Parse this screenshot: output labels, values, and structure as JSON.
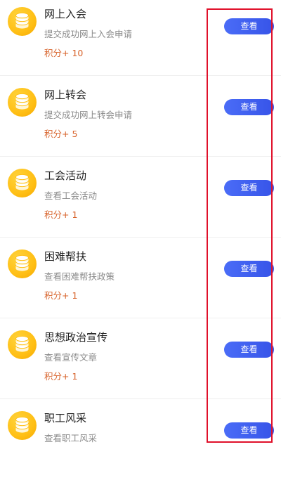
{
  "colors": {
    "button": "#3f5ff0",
    "points": "#d7622a",
    "coin": "#ffbf15",
    "highlight": "#e0102a"
  },
  "items": [
    {
      "title": "网上入会",
      "desc": "提交成功网上入会申请",
      "points": "积分+ 10",
      "button": "查看",
      "icon": "coin-stack-icon"
    },
    {
      "title": "网上转会",
      "desc": "提交成功网上转会申请",
      "points": "积分+ 5",
      "button": "查看",
      "icon": "coin-stack-icon"
    },
    {
      "title": "工会活动",
      "desc": "查看工会活动",
      "points": "积分+ 1",
      "button": "查看",
      "icon": "coin-stack-icon"
    },
    {
      "title": "困难帮扶",
      "desc": "查看困难帮扶政策",
      "points": "积分+ 1",
      "button": "查看",
      "icon": "coin-stack-icon"
    },
    {
      "title": "思想政治宣传",
      "desc": "查看宣传文章",
      "points": "积分+ 1",
      "button": "查看",
      "icon": "coin-stack-icon"
    },
    {
      "title": "职工风采",
      "desc": "查看职工风采",
      "points": "",
      "button": "查看",
      "icon": "coin-stack-icon"
    }
  ]
}
